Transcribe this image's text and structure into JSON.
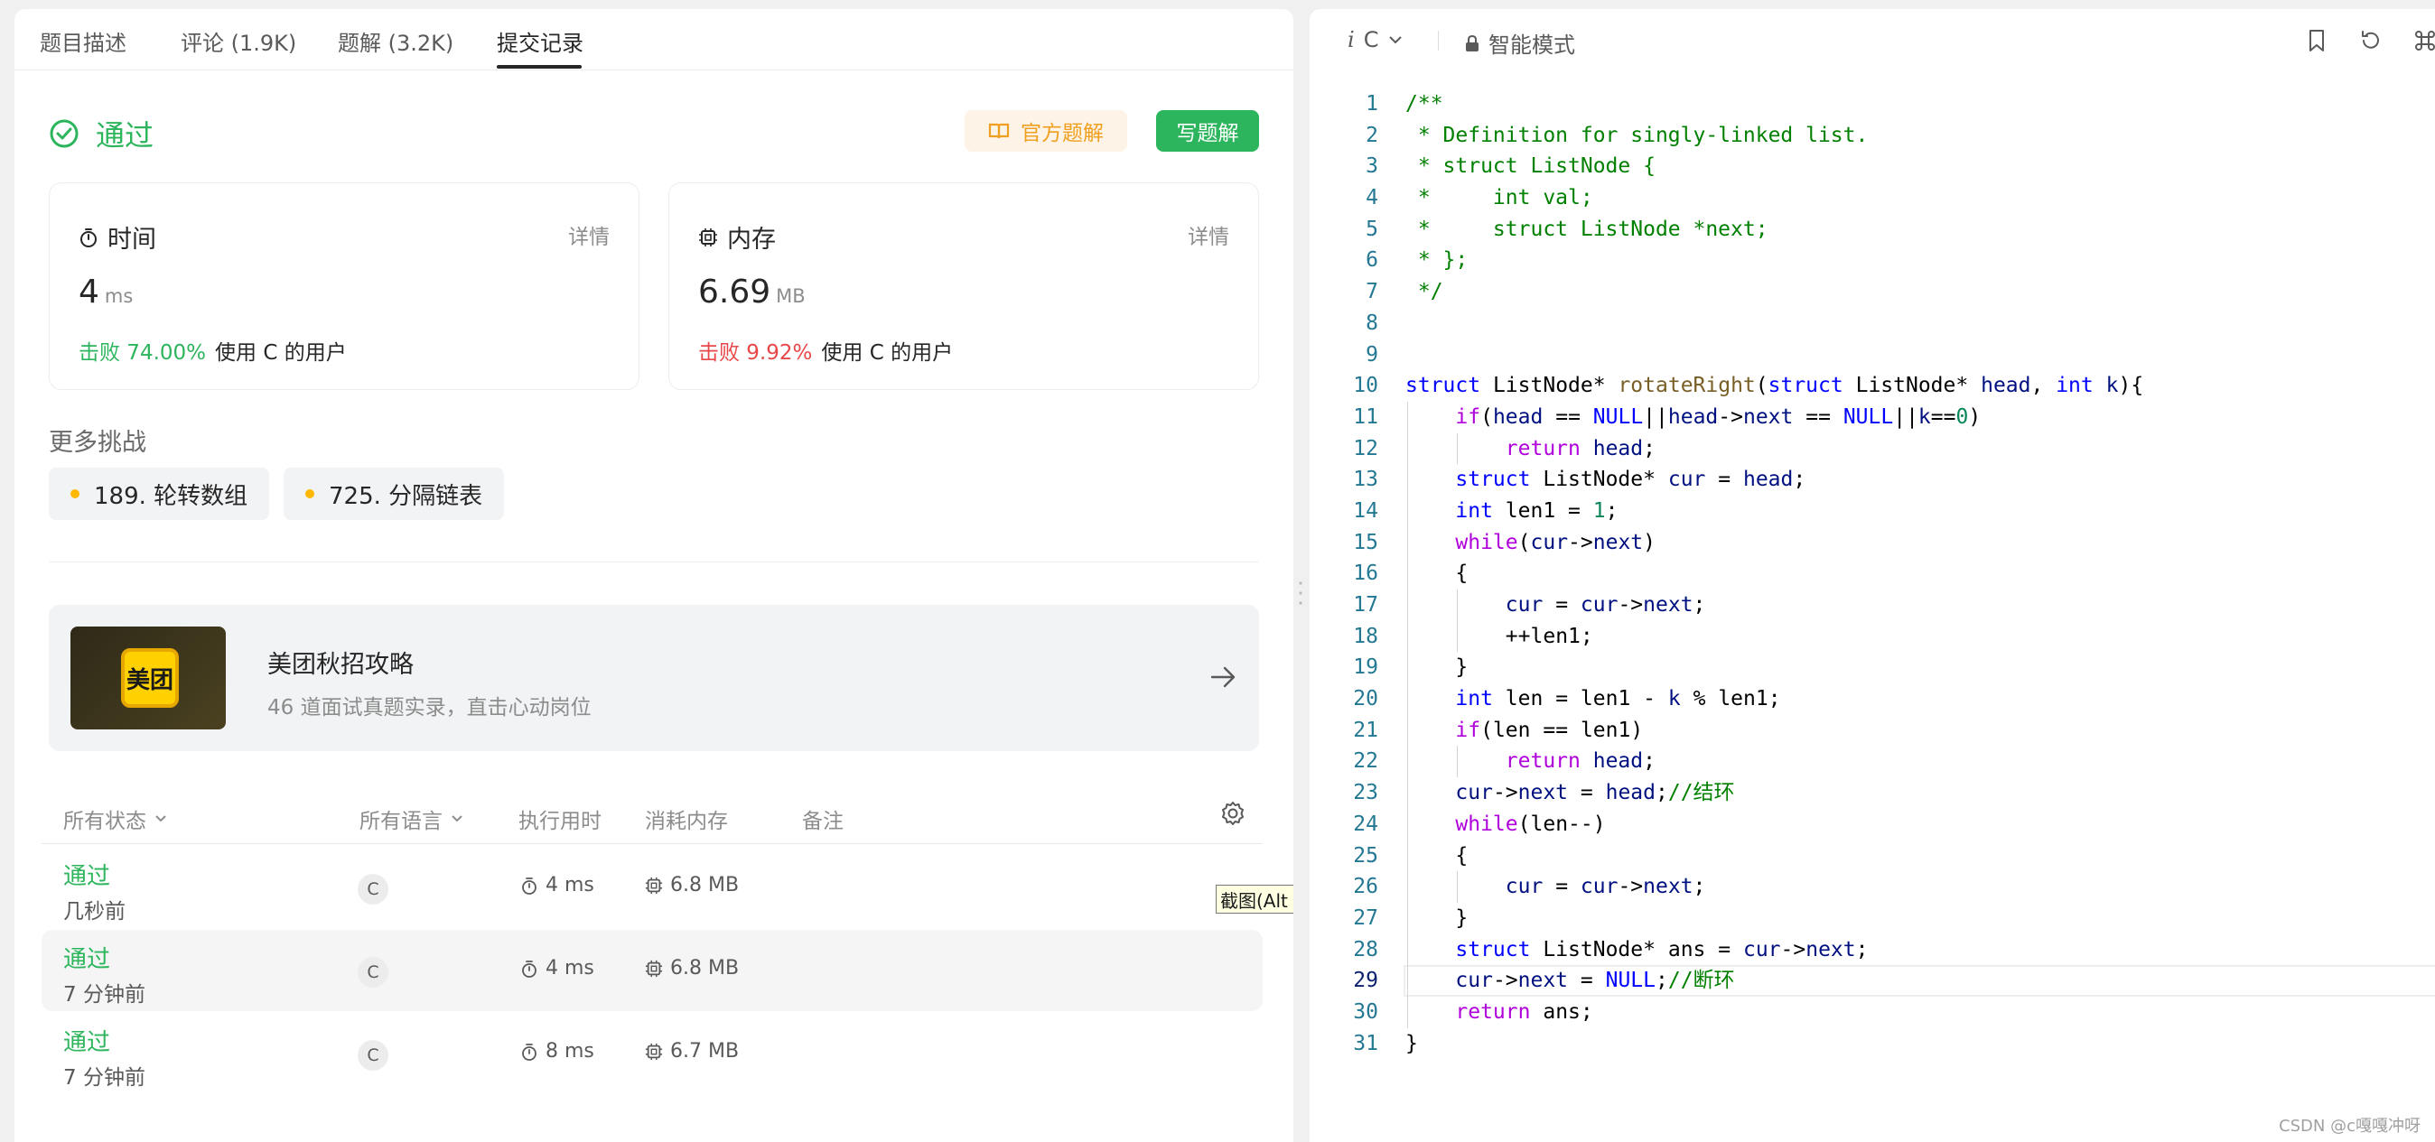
{
  "tabs": [
    {
      "label": "题目描述"
    },
    {
      "label": "评论 (1.9K)"
    },
    {
      "label": "题解 (3.2K)"
    },
    {
      "label": "提交记录"
    }
  ],
  "result": {
    "status": "通过",
    "official_solution_label": "官方题解",
    "write_solution_label": "写题解"
  },
  "time_card": {
    "title": "时间",
    "detail": "详情",
    "value": "4",
    "unit": "ms",
    "beat": "击败 74.00%",
    "users": "使用 C 的用户"
  },
  "memory_card": {
    "title": "内存",
    "detail": "详情",
    "value": "6.69",
    "unit": "MB",
    "beat": "击败 9.92%",
    "users": "使用 C 的用户"
  },
  "more_challenges": {
    "title": "更多挑战",
    "items": [
      {
        "label": "189. 轮转数组"
      },
      {
        "label": "725. 分隔链表"
      }
    ]
  },
  "promo": {
    "logo_text": "美团",
    "title": "美团秋招攻略",
    "subtitle": "46 道面试真题实录，直击心动岗位"
  },
  "table": {
    "headers": {
      "status": "所有状态",
      "language": "所有语言",
      "runtime": "执行用时",
      "memory": "消耗内存",
      "note": "备注"
    },
    "rows": [
      {
        "status": "通过",
        "time": "几秒前",
        "lang": "C",
        "runtime": "4 ms",
        "memory": "6.8 MB"
      },
      {
        "status": "通过",
        "time": "7 分钟前",
        "lang": "C",
        "runtime": "4 ms",
        "memory": "6.8 MB"
      },
      {
        "status": "通过",
        "time": "7 分钟前",
        "lang": "C",
        "runtime": "8 ms",
        "memory": "6.7 MB"
      }
    ]
  },
  "tooltip": "截图(Alt + A)",
  "editor": {
    "language_prefix": "i",
    "language": "C",
    "mode": "智能模式",
    "current_line": 29
  },
  "code_lines": [
    "/**",
    " * Definition for singly-linked list.",
    " * struct ListNode {",
    " *     int val;",
    " *     struct ListNode *next;",
    " * };",
    " */",
    "",
    "",
    "struct ListNode* rotateRight(struct ListNode* head, int k){",
    "    if(head == NULL||head->next == NULL||k==0)",
    "        return head;",
    "    struct ListNode* cur = head;",
    "    int len1 = 1;",
    "    while(cur->next)",
    "    {",
    "        cur = cur->next;",
    "        ++len1;",
    "    }",
    "    int len = len1 - k % len1;",
    "    if(len == len1)",
    "        return head;",
    "    cur->next = head;//结环",
    "    while(len--)",
    "    {",
    "        cur = cur->next;",
    "    }",
    "    struct ListNode* ans = cur->next;",
    "    cur->next = NULL;//断环",
    "    return ans;",
    "}"
  ],
  "watermark": "CSDN @c嘎嘎冲呀",
  "colors": {
    "accept_green": "#2db55d",
    "fail_red": "#e84749",
    "official_orange": "#f0a020",
    "line_number": "#237893"
  }
}
